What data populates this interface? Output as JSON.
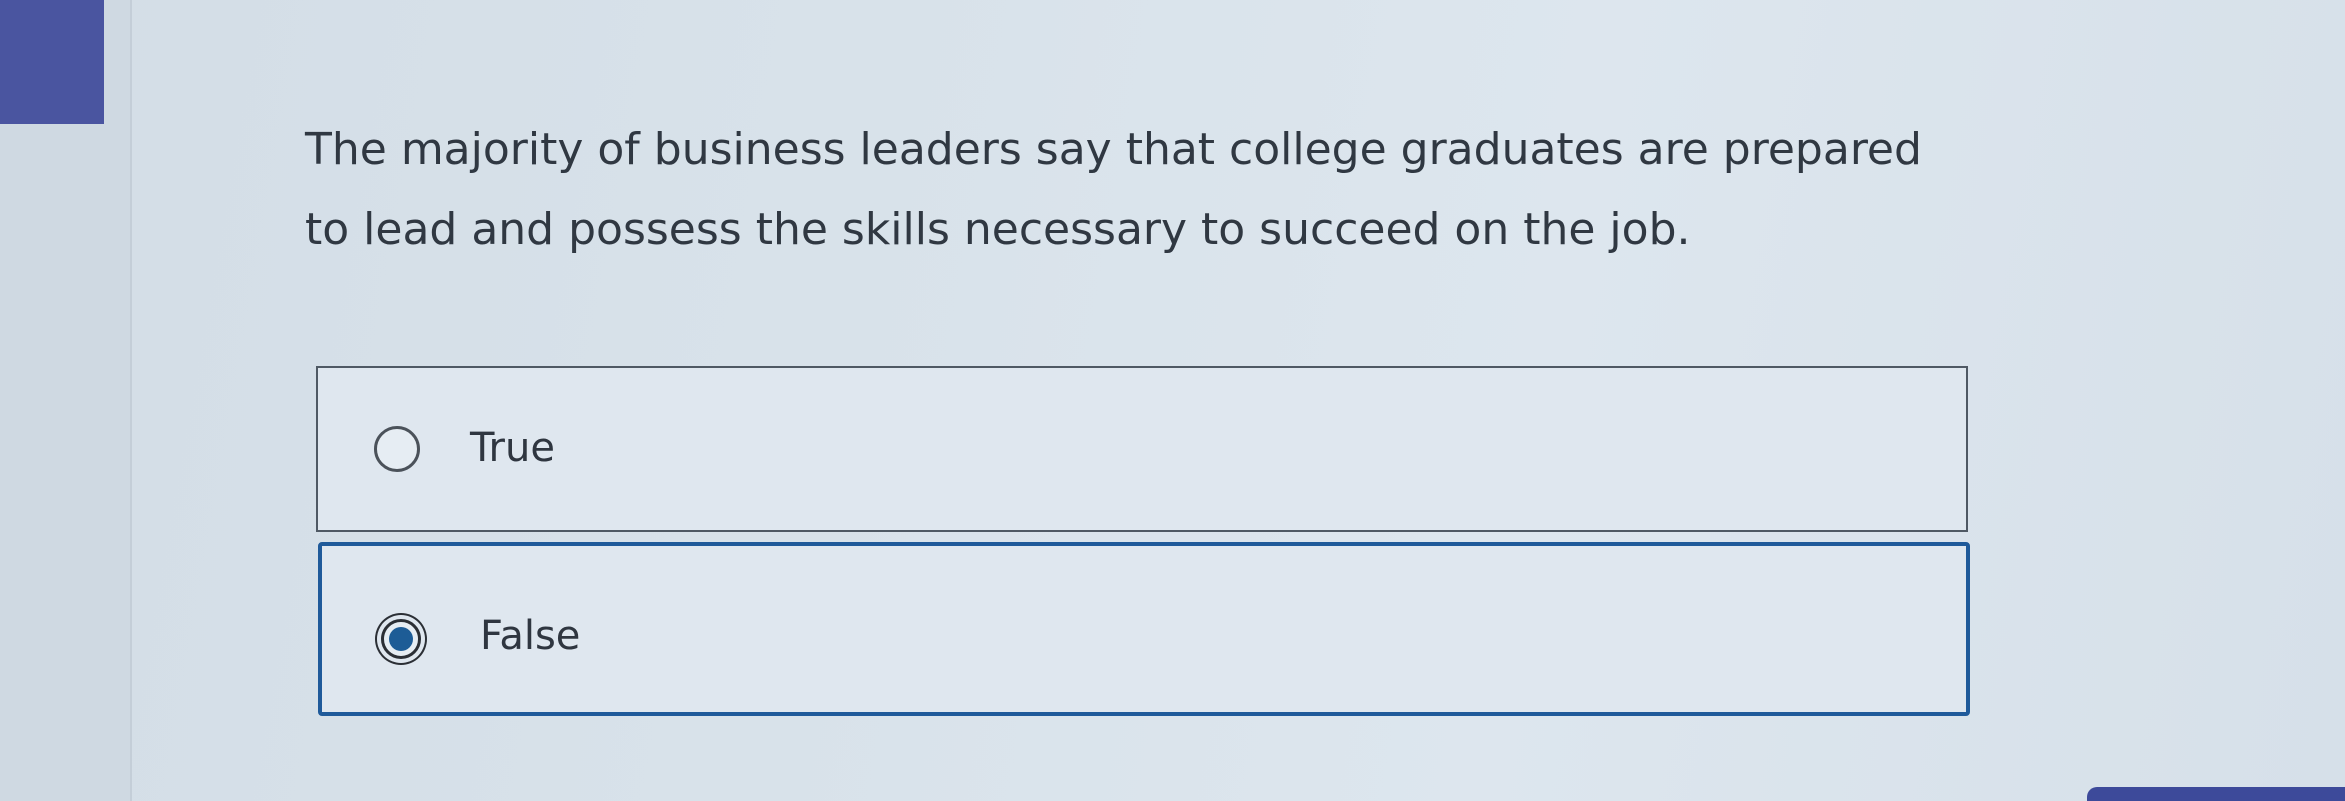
{
  "question": {
    "text": "The majority of business leaders say that college graduates are prepared to lead and possess the skills necessary to succeed on the job."
  },
  "options": [
    {
      "label": "True",
      "selected": false
    },
    {
      "label": "False",
      "selected": true
    }
  ],
  "colors": {
    "accent": "#4a55a0",
    "selected_border": "#1f5a9a",
    "radio_fill": "#1d5c96"
  }
}
